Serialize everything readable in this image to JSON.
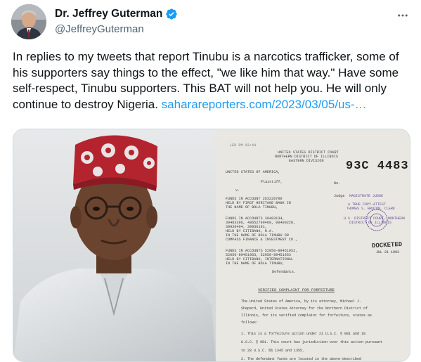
{
  "author": {
    "display_name": "Dr. Jeffrey Guterman",
    "handle": "@JeffreyGuterman",
    "verified_icon": "verified-badge-icon",
    "verified_color": "#1d9bf0"
  },
  "more_icon": "more-options-icon",
  "tweet": {
    "text": "In replies to my tweets that report Tinubu is a narcotics trafficker, some of his supporters say things to the effect, \"we like him that way.\" Have some self-respect, Tinubu supporters. This BAT will not help you. He will only continue to destroy Nigeria. ",
    "link": "saharareporters.com/2023/03/05/us-…",
    "link_color": "#1d9bf0"
  },
  "document": {
    "court_header_1": "UNITED STATES DISTRICT COURT",
    "court_header_2": "NORTHERN DISTRICT OF ILLINOIS",
    "court_header_3": "EASTERN DIVISION",
    "case_number": "93C 4483",
    "plaintiff": "UNITED STATES OF AMERICA,",
    "plaintiff_role": "Plaintiff,",
    "versus": "v.",
    "no_label": "No.",
    "judge_label": "Judge",
    "stamp_lines": [
      "MAGISTRATE JUDGE",
      "A TRUE COPY-ATTEST",
      "THOMAS S. BRUTON, CLERK",
      "U.S. DISTRICT COURT, NORTHERN",
      "DISTRICT OF ILLINOIS"
    ],
    "funds_1": [
      "FUNDS IN ACCOUNT 263226700",
      "HELD BY FIRST HERITAGE BANK IN",
      "THE NAME OF BOLA TINUBU,"
    ],
    "funds_2": [
      "FUNDS IN ACCOUNTS 39483134,",
      "39483396, 48652799468, 00400220,",
      "39936404, 39936191,",
      "HELD BY CITIBANK, N.A.",
      "IN THE NAME OF BOLA TINUBU OR",
      "COMPASS FINANCE & INVESTMENT CO.,"
    ],
    "funds_3": [
      "FUNDS IN ACCOUNTS 52050-89451952,",
      "52050-89451953, 52050-89451953",
      "HELD BY CITIBANK, INTERNATIONAL",
      "IN THE NAME OF BOLA TINUBU,"
    ],
    "defendants": "Defendants.",
    "docketed": "DOCKETED",
    "docketed_date": "JUL 21 1993",
    "complaint_title": "VERIFIED COMPLAINT FOR FORFEITURE",
    "body_lines": [
      "The United States of America, by its attorney, Michael J.",
      "Shepard, United States Attorney for the Northern District of",
      "Illinois, for its verified complaint for forfeiture, states as",
      "follows:",
      "1.   This is a forfeiture action under 21 U.S.C. § 881 and 18",
      "U.S.C. § 981. This court has jurisdiction over this action pursuant",
      "to 28 U.S.C. §§ 1345 and 1355.",
      "2.   The defendant funds are located in the above-described"
    ]
  }
}
